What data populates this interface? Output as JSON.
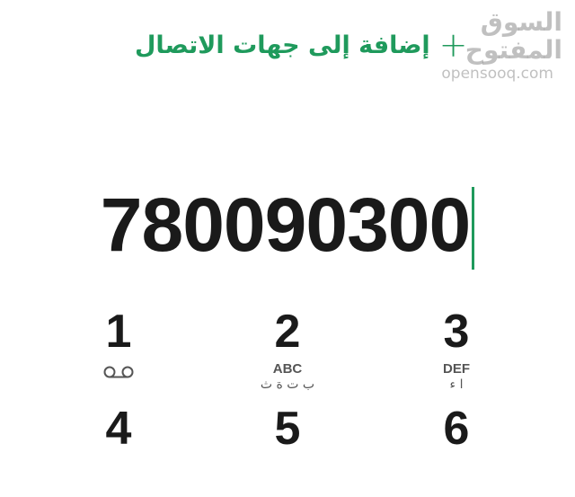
{
  "header": {
    "add_contact_label": "إضافة إلى جهات الاتصال",
    "add_icon": "+"
  },
  "watermark": {
    "arabic": "السوق المفتوح",
    "latin": "opensooq.com"
  },
  "display": {
    "number": "780090300"
  },
  "keypad": {
    "keys": [
      {
        "digit": "1",
        "latin": "",
        "arabic": "",
        "icon": "voicemail-icon"
      },
      {
        "digit": "2",
        "latin": "ABC",
        "arabic": "ب ت ة ث"
      },
      {
        "digit": "3",
        "latin": "DEF",
        "arabic": "ا ء"
      },
      {
        "digit": "4",
        "latin": "",
        "arabic": ""
      },
      {
        "digit": "5",
        "latin": "",
        "arabic": ""
      },
      {
        "digit": "6",
        "latin": "",
        "arabic": ""
      }
    ]
  },
  "colors": {
    "accent": "#1f9a5c",
    "text": "#1a1a1a",
    "background": "#ffffff"
  }
}
